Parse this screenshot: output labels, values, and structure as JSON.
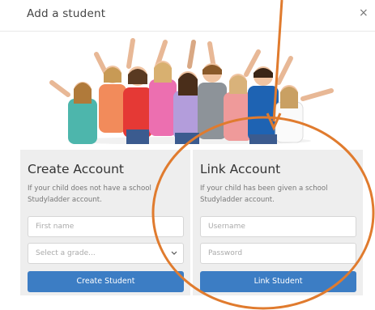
{
  "modal": {
    "title": "Add a student",
    "close_label": "×"
  },
  "create_account": {
    "title": "Create Account",
    "description": "If your child does not have a school Studyladder account.",
    "first_name_placeholder": "First name",
    "grade_select_value": "Select a grade...",
    "button_label": "Create Student"
  },
  "link_account": {
    "title": "Link Account",
    "description": "If your child has been given a school Studyladder account.",
    "username_placeholder": "Username",
    "password_placeholder": "Password",
    "button_label": "Link Student"
  },
  "colors": {
    "button_blue": "#3c7dc4",
    "annotation_orange": "#e07b2e",
    "panel_gray": "#eeeeee"
  },
  "icons": {
    "close": "close-icon",
    "select_chevron": "chevron-down-icon"
  }
}
